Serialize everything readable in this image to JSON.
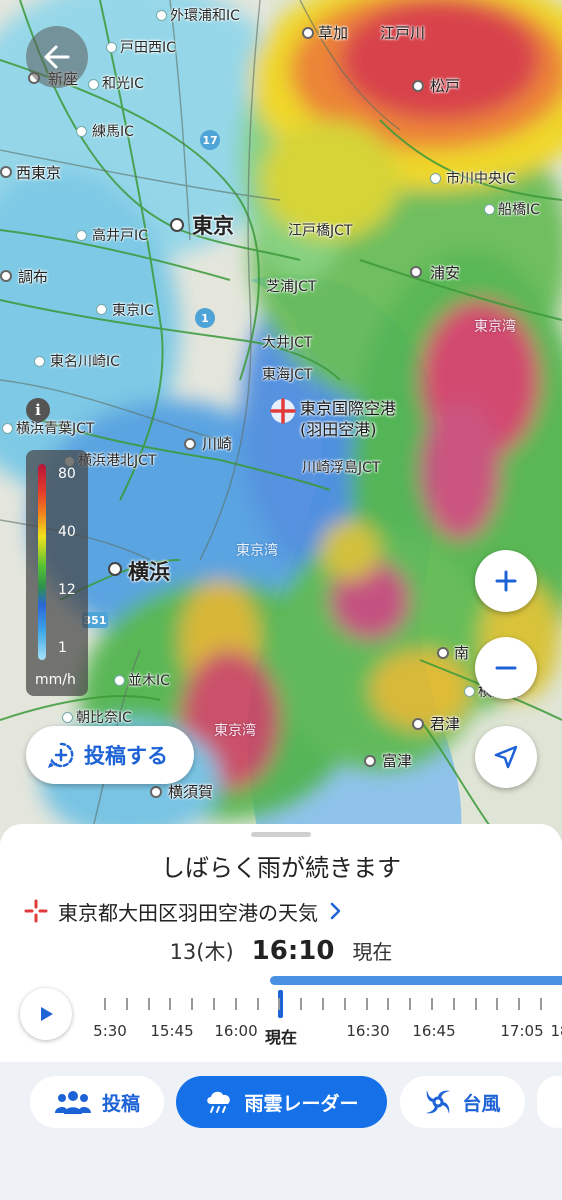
{
  "map": {
    "places": [
      {
        "name": "外環浦和IC",
        "type": "ic"
      },
      {
        "name": "草加",
        "type": "city"
      },
      {
        "name": "江戸川",
        "type": "city"
      },
      {
        "name": "戸田西IC",
        "type": "ic"
      },
      {
        "name": "新座",
        "type": "city"
      },
      {
        "name": "和光IC",
        "type": "ic"
      },
      {
        "name": "松戸",
        "type": "city"
      },
      {
        "name": "練馬IC",
        "type": "ic"
      },
      {
        "name": "西東京",
        "type": "city"
      },
      {
        "name": "市川中央IC",
        "type": "ic"
      },
      {
        "name": "船橋IC",
        "type": "ic"
      },
      {
        "name": "東京",
        "type": "big"
      },
      {
        "name": "高井戸IC",
        "type": "ic"
      },
      {
        "name": "江戸橋JCT",
        "type": "ic"
      },
      {
        "name": "調布",
        "type": "city"
      },
      {
        "name": "浦安",
        "type": "city"
      },
      {
        "name": "芝浦JCT",
        "type": "ic"
      },
      {
        "name": "東京IC",
        "type": "ic"
      },
      {
        "name": "東京湾",
        "type": "sea2"
      },
      {
        "name": "大井JCT",
        "type": "ic"
      },
      {
        "name": "東名川崎IC",
        "type": "ic"
      },
      {
        "name": "東海JCT",
        "type": "ic"
      },
      {
        "name": "横浜青葉JCT",
        "type": "ic"
      },
      {
        "name": "川崎",
        "type": "city"
      },
      {
        "name": "横浜港北JCT",
        "type": "ic"
      },
      {
        "name": "川崎浮島JCT",
        "type": "ic"
      },
      {
        "name": "東京湾",
        "type": "sea"
      },
      {
        "name": "横浜",
        "type": "big"
      },
      {
        "name": "木更津",
        "type": "city"
      },
      {
        "name": "並木IC",
        "type": "ic"
      },
      {
        "name": "君津",
        "type": "city"
      },
      {
        "name": "朝比奈IC",
        "type": "ic"
      },
      {
        "name": "東京湾",
        "type": "sea2"
      },
      {
        "name": "富津",
        "type": "city"
      },
      {
        "name": "横須賀",
        "type": "city"
      },
      {
        "name": "南",
        "type": "city"
      },
      {
        "name": "木",
        "type": "city"
      }
    ],
    "airport": {
      "line1": "東京国際空港",
      "line2": "(羽田空港)"
    },
    "route_numbers": [
      "17",
      "1",
      "351"
    ],
    "legend": {
      "ticks": [
        "80",
        "40",
        "12",
        "1"
      ],
      "unit": "mm/h"
    },
    "post_button": "投稿する"
  },
  "sheet": {
    "headline": "しばらく雨が続きます",
    "location": "東京都大田区羽田空港の天気",
    "date": "13(木)",
    "time": "16:10",
    "now_label": "現在",
    "timeline_labels": [
      "5:30",
      "15:45",
      "16:00",
      "現在",
      "16:30",
      "16:45",
      "17:05",
      "18"
    ],
    "loaded_progress": 0.52
  },
  "tabs": [
    {
      "label": "投稿",
      "icon": "people-icon",
      "active": false
    },
    {
      "label": "雨雲レーダー",
      "icon": "rain-cloud-icon",
      "active": true
    },
    {
      "label": "台風",
      "icon": "typhoon-icon",
      "active": false
    }
  ],
  "colors": {
    "accent": "#1670e8",
    "accent_text": "#1e63d6",
    "airport": "#e03a3a"
  }
}
